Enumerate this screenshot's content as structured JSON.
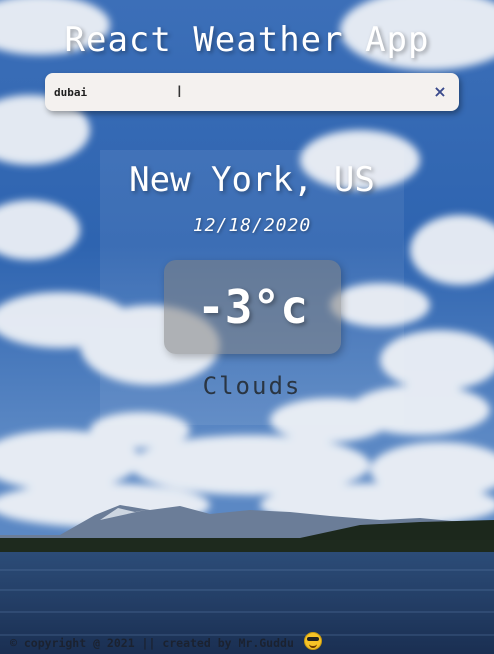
{
  "app": {
    "title": "React Weather App"
  },
  "search": {
    "value": "dubai",
    "clear_label": "×"
  },
  "weather": {
    "location": "New York, US",
    "date": "12/18/2020",
    "temperature": "-3°c",
    "condition": "Clouds"
  },
  "footer": {
    "text": "© copyright @ 2021 || created by Mr.Guddu ",
    "emoji_icon": "sunglasses-face-icon"
  },
  "colors": {
    "sky_top": "#2d5fa8",
    "water": "#1f3b63",
    "text_white": "#ffffff",
    "condition_text": "#2a3542"
  }
}
